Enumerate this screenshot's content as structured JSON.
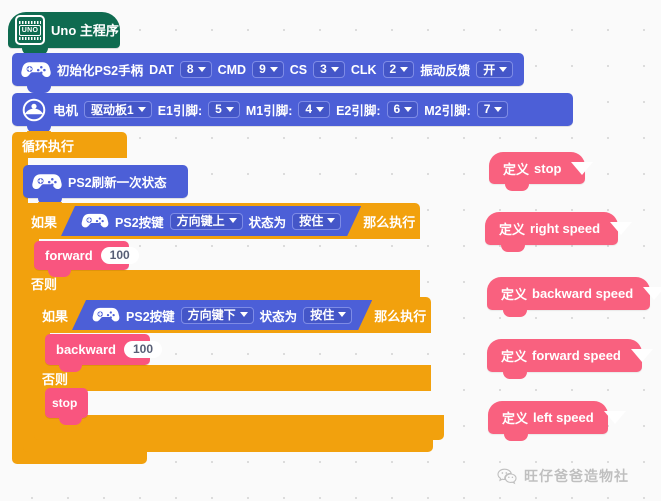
{
  "app": {
    "type": "block-based-visual-programming-editor",
    "canvas_background": "#fafafa",
    "grid_dot_color": "#dcdcdc"
  },
  "colors": {
    "hat_green": "#0f6b50",
    "block_blue": "#4c5fd7",
    "control_orange": "#f2a10d",
    "custom_pink": "#f9557f",
    "define_pink": "#f9617f",
    "field_white": "#ffffff"
  },
  "hat_block": {
    "label": "Uno 主程序",
    "badge_text": "UNO",
    "icon": "uno-board-icon"
  },
  "init_ps2_block": {
    "icon": "gamepad-icon",
    "label": "初始化PS2手柄",
    "fields": [
      {
        "label": "DAT",
        "value": "8"
      },
      {
        "label": "CMD",
        "value": "9"
      },
      {
        "label": "CS",
        "value": "3"
      },
      {
        "label": "CLK",
        "value": "2"
      },
      {
        "label": "振动反馈",
        "value": "开"
      }
    ]
  },
  "motor_block": {
    "icon": "motor-driver-icon",
    "label": "电机",
    "board_field": {
      "value": "驱动板1"
    },
    "fields": [
      {
        "label": "E1引脚:",
        "value": "5"
      },
      {
        "label": "M1引脚:",
        "value": "4"
      },
      {
        "label": "E2引脚:",
        "value": "6"
      },
      {
        "label": "M2引脚:",
        "value": "7"
      }
    ]
  },
  "forever_block": {
    "label": "循环执行"
  },
  "ps2_refresh_block": {
    "icon": "gamepad-icon",
    "label": "PS2刷新一次状态"
  },
  "if_outer": {
    "if_label": "如果",
    "then_label": "那么执行",
    "else_label": "否则",
    "condition": {
      "icon": "gamepad-icon",
      "label": "PS2按键",
      "button_field": "方向键上",
      "state_label": "状态为",
      "state_field": "按住"
    },
    "body_block": {
      "name": "forward",
      "value": "100"
    }
  },
  "if_inner": {
    "if_label": "如果",
    "then_label": "那么执行",
    "else_label": "否则",
    "condition": {
      "icon": "gamepad-icon",
      "label": "PS2按键",
      "button_field": "方向键下",
      "state_label": "状态为",
      "state_field": "按住"
    },
    "body_block": {
      "name": "backward",
      "value": "100"
    },
    "else_block": {
      "name": "stop"
    }
  },
  "definitions": [
    {
      "prefix": "定义",
      "name": "stop"
    },
    {
      "prefix": "定义",
      "name": "right speed"
    },
    {
      "prefix": "定义",
      "name": "backward speed"
    },
    {
      "prefix": "定义",
      "name": "forward speed"
    },
    {
      "prefix": "定义",
      "name": "left speed"
    }
  ],
  "watermark": {
    "text": "旺仔爸爸造物社",
    "icon": "wechat-icon"
  }
}
